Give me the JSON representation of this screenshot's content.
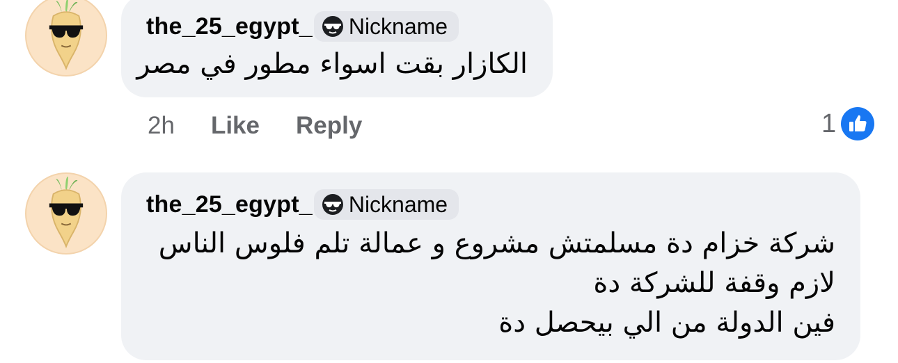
{
  "comments": [
    {
      "author": "the_25_egypt_",
      "badge": "Nickname",
      "lines": [
        "الكازار بقت اسواء مطور في مصر"
      ],
      "time": "2h",
      "like_label": "Like",
      "reply_label": "Reply",
      "reaction_count": "1"
    },
    {
      "author": "the_25_egypt_",
      "badge": "Nickname",
      "lines": [
        "شركة خزام دة مسلمتش مشروع و عمالة تلم فلوس الناس",
        "لازم وقفة للشركة دة",
        "فين الدولة من الي بيحصل دة"
      ]
    }
  ],
  "icons": {
    "avatar": "radish-sunglasses-avatar-icon",
    "badge": "sunglasses-face-icon",
    "reaction": "thumbs-up-icon"
  },
  "colors": {
    "bubble": "#f0f2f5",
    "badge_bg": "#e4e6eb",
    "like_blue": "#1877f2",
    "secondary_text": "#65676b",
    "avatar_bg": "#fbe3c6"
  }
}
